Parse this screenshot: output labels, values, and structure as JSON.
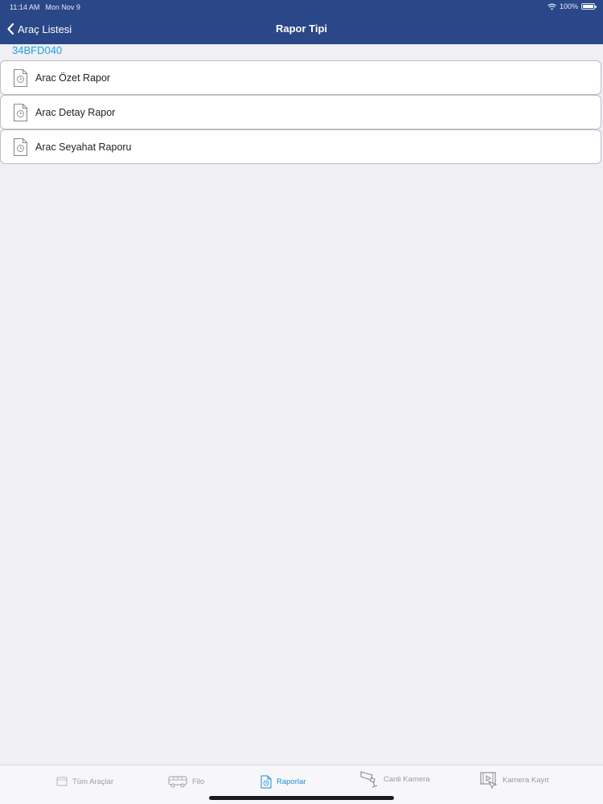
{
  "status_bar": {
    "time": "11:14 AM",
    "date": "Mon Nov 9",
    "battery_text": "100%",
    "battery_level": 1.0
  },
  "nav": {
    "back_label": "Araç Listesi",
    "title": "Rapor Tipi"
  },
  "vehicle": {
    "plate": "34BFD040"
  },
  "reports": {
    "items": [
      {
        "label": "Arac Özet Rapor",
        "icon": "report-document-icon"
      },
      {
        "label": "Arac Detay Rapor",
        "icon": "report-document-icon"
      },
      {
        "label": "Arac Seyahat Raporu",
        "icon": "report-document-icon"
      }
    ]
  },
  "tabs": [
    {
      "label": "Tüm Araçlar",
      "icon": "vehicles-list-icon",
      "active": false
    },
    {
      "label": "Filo",
      "icon": "bus-icon",
      "active": false
    },
    {
      "label": "Raporlar",
      "icon": "report-document-icon",
      "active": true
    },
    {
      "label": "Canli Kamera",
      "icon": "cctv-camera-icon",
      "active": false
    },
    {
      "label": "Kamera Kayıt",
      "icon": "camera-recording-icon",
      "active": false
    }
  ],
  "colors": {
    "header_bg": "#2a4787",
    "accent": "#1e8fd6",
    "plate_color": "#19a3e0",
    "background": "#efeff4"
  }
}
